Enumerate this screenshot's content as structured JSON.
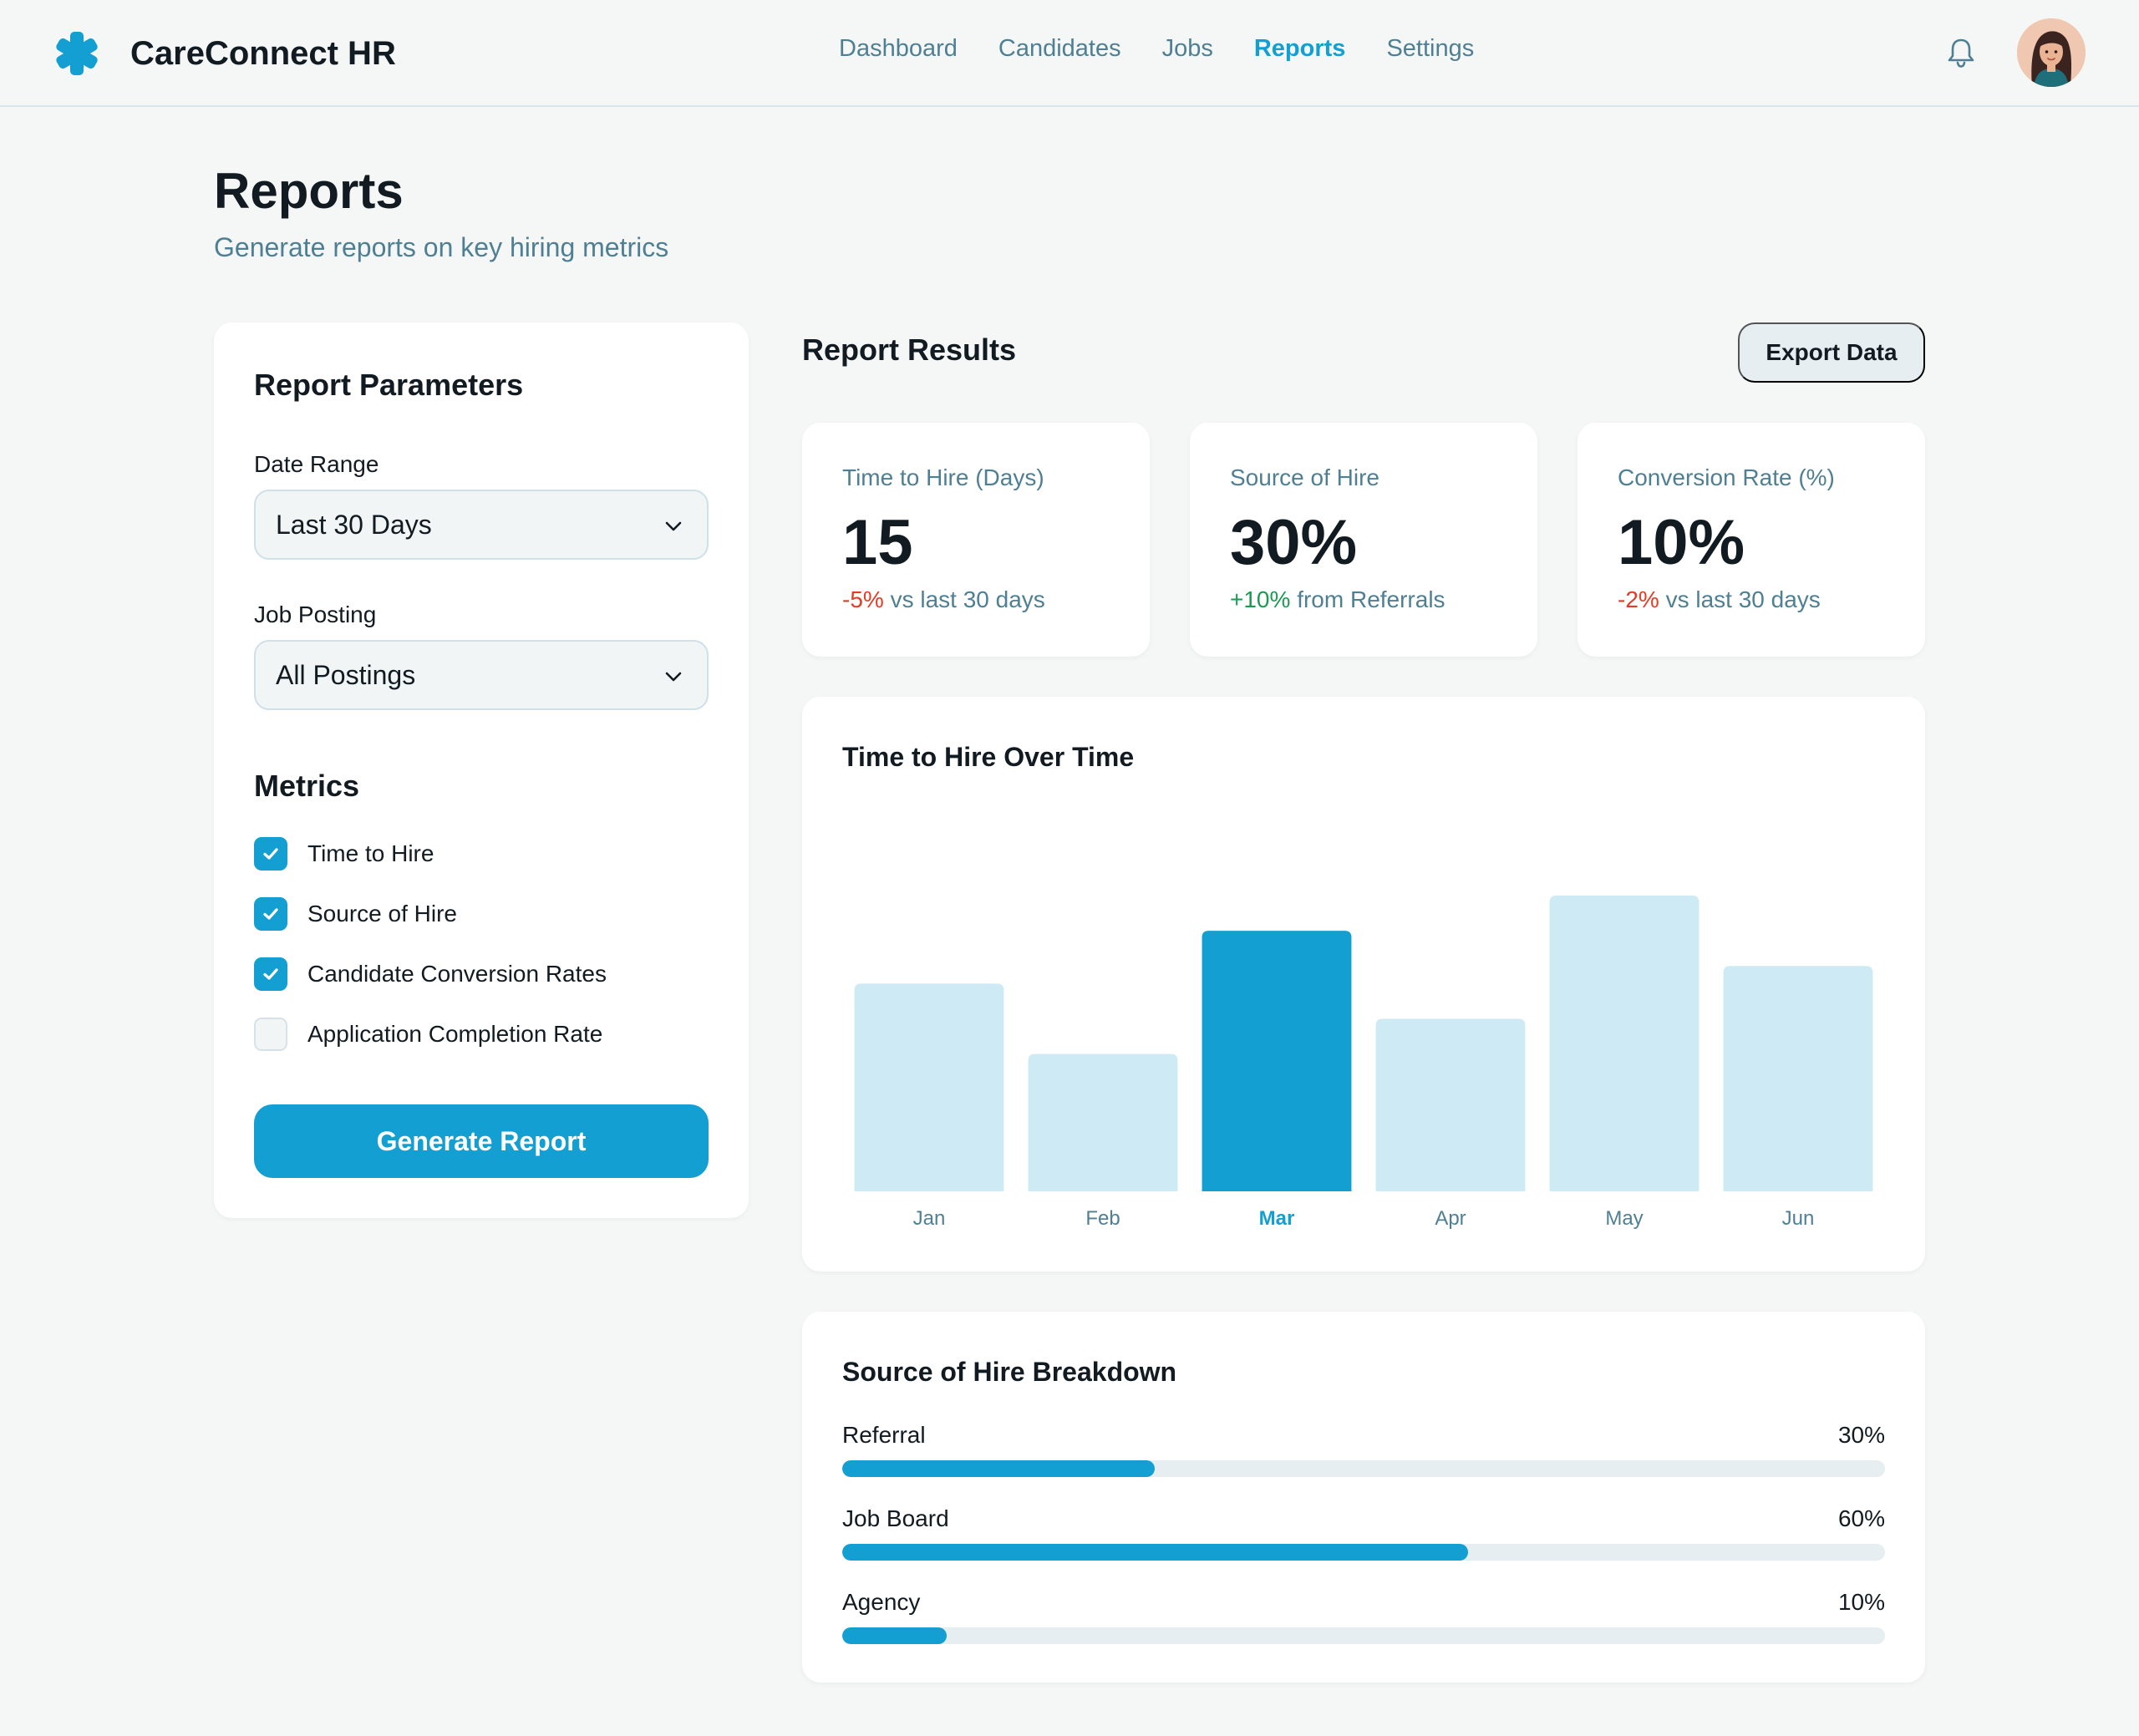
{
  "app": {
    "brand": "CareConnect HR",
    "accent_color": "#149fd3"
  },
  "nav": {
    "items": [
      {
        "label": "Dashboard",
        "active": false
      },
      {
        "label": "Candidates",
        "active": false
      },
      {
        "label": "Jobs",
        "active": false
      },
      {
        "label": "Reports",
        "active": true
      },
      {
        "label": "Settings",
        "active": false
      }
    ],
    "icons": {
      "bell": "bell-icon",
      "avatar": "user-avatar"
    }
  },
  "page": {
    "title": "Reports",
    "subtitle": "Generate reports on key hiring metrics"
  },
  "parameters": {
    "title": "Report Parameters",
    "date_range": {
      "label": "Date Range",
      "value": "Last 30 Days"
    },
    "job_posting": {
      "label": "Job Posting",
      "value": "All Postings"
    },
    "metrics_title": "Metrics",
    "metrics": [
      {
        "label": "Time to Hire",
        "checked": true
      },
      {
        "label": "Source of Hire",
        "checked": true
      },
      {
        "label": "Candidate Conversion Rates",
        "checked": true
      },
      {
        "label": "Application Completion Rate",
        "checked": false
      }
    ],
    "generate_label": "Generate Report"
  },
  "results": {
    "title": "Report Results",
    "export_label": "Export Data",
    "stats": [
      {
        "label": "Time to Hire (Days)",
        "value": "15",
        "delta": "-5%",
        "delta_text": "vs last 30 days",
        "delta_tone": "neg"
      },
      {
        "label": "Source of Hire",
        "value": "30%",
        "delta": "+10%",
        "delta_text": "from Referrals",
        "delta_tone": "pos"
      },
      {
        "label": "Conversion Rate (%)",
        "value": "10%",
        "delta": "-2%",
        "delta_text": "vs last 30 days",
        "delta_tone": "neg"
      }
    ]
  },
  "chart_data": {
    "type": "bar",
    "title": "Time to Hire Over Time",
    "categories": [
      "Jan",
      "Feb",
      "Mar",
      "Apr",
      "May",
      "Jun"
    ],
    "values": [
      59,
      39,
      74,
      49,
      84,
      64
    ],
    "ylim": [
      0,
      84
    ],
    "highlight": "Mar",
    "grid": false,
    "colors": {
      "bar": "#cdeaf5",
      "highlight": "#149fd3",
      "label": "#4f7f93"
    }
  },
  "source_breakdown": {
    "title": "Source of Hire Breakdown",
    "items": [
      {
        "label": "Referral",
        "percent_text": "30%",
        "value": 30
      },
      {
        "label": "Job Board",
        "percent_text": "60%",
        "value": 60
      },
      {
        "label": "Agency",
        "percent_text": "10%",
        "value": 10
      }
    ]
  }
}
